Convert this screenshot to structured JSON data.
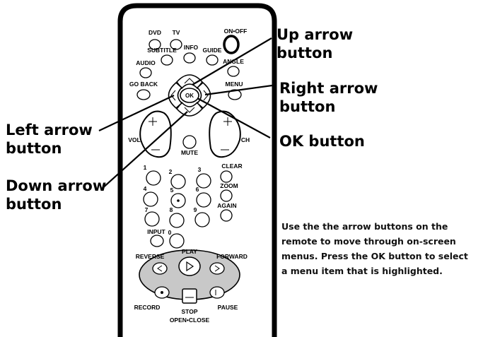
{
  "remote": {
    "buttons": {
      "dvd": "DVD",
      "tv": "TV",
      "on_off": "ON•OFF",
      "subtitle": "SUBTITLE",
      "info": "INFO",
      "guide": "GUIDE",
      "audio": "AUDIO",
      "angle": "ANGLE",
      "go_back": "GO BACK",
      "menu": "MENU",
      "ok": "OK",
      "vol": "VOL",
      "ch": "CH",
      "mute": "MUTE",
      "clear": "CLEAR",
      "zoom": "ZOOM",
      "again": "AGAIN",
      "input": "INPUT",
      "digits": [
        "1",
        "2",
        "3",
        "4",
        "5",
        "6",
        "7",
        "8",
        "9",
        "0"
      ],
      "reverse": "REVERSE",
      "play": "PLAY",
      "forward": "FORWARD",
      "record": "RECORD",
      "pause": "PAUSE",
      "stop": "STOP",
      "open_close": "OPEN•CLOSE"
    }
  },
  "callouts": {
    "up_arrow": "Up arrow\nbutton",
    "right_arrow": "Right arrow\nbutton",
    "ok": "OK button",
    "left_arrow": "Left arrow\nbutton",
    "down_arrow": "Down arrow\nbutton"
  },
  "note_lines": [
    "Use the the arrow buttons on the",
    "remote to move through on-screen",
    "menus. Press the OK button to select",
    "a menu item that is highlighted."
  ]
}
